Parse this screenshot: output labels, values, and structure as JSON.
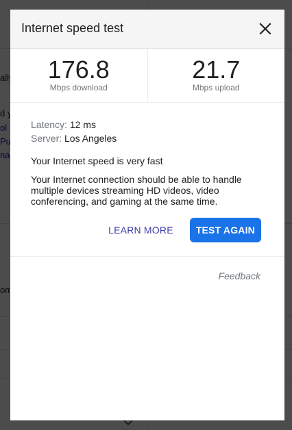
{
  "background": {
    "snippets": [
      {
        "text": "ally",
        "link": false
      },
      {
        "text": "d y",
        "link": false
      },
      {
        "text": "ol",
        "link": true
      },
      {
        "text": "Pu",
        "link": true
      },
      {
        "text": "na",
        "link": true
      },
      {
        "text": "om",
        "link": false
      }
    ]
  },
  "dialog": {
    "title": "Internet speed test",
    "download": {
      "value": "176.8",
      "unit": "Mbps download"
    },
    "upload": {
      "value": "21.7",
      "unit": "Mbps upload"
    },
    "latency_label": "Latency:",
    "latency_value": "12 ms",
    "server_label": "Server:",
    "server_value": "Los Angeles",
    "verdict": "Your Internet speed is very fast",
    "description": "Your Internet connection should be able to handle multiple devices streaming HD videos, video conferencing, and gaming at the same time.",
    "learn_more_label": "LEARN MORE",
    "test_again_label": "TEST AGAIN",
    "feedback_label": "Feedback"
  },
  "colors": {
    "accent": "#1a73e8",
    "link": "#3c3ca8",
    "muted": "#70757a"
  }
}
